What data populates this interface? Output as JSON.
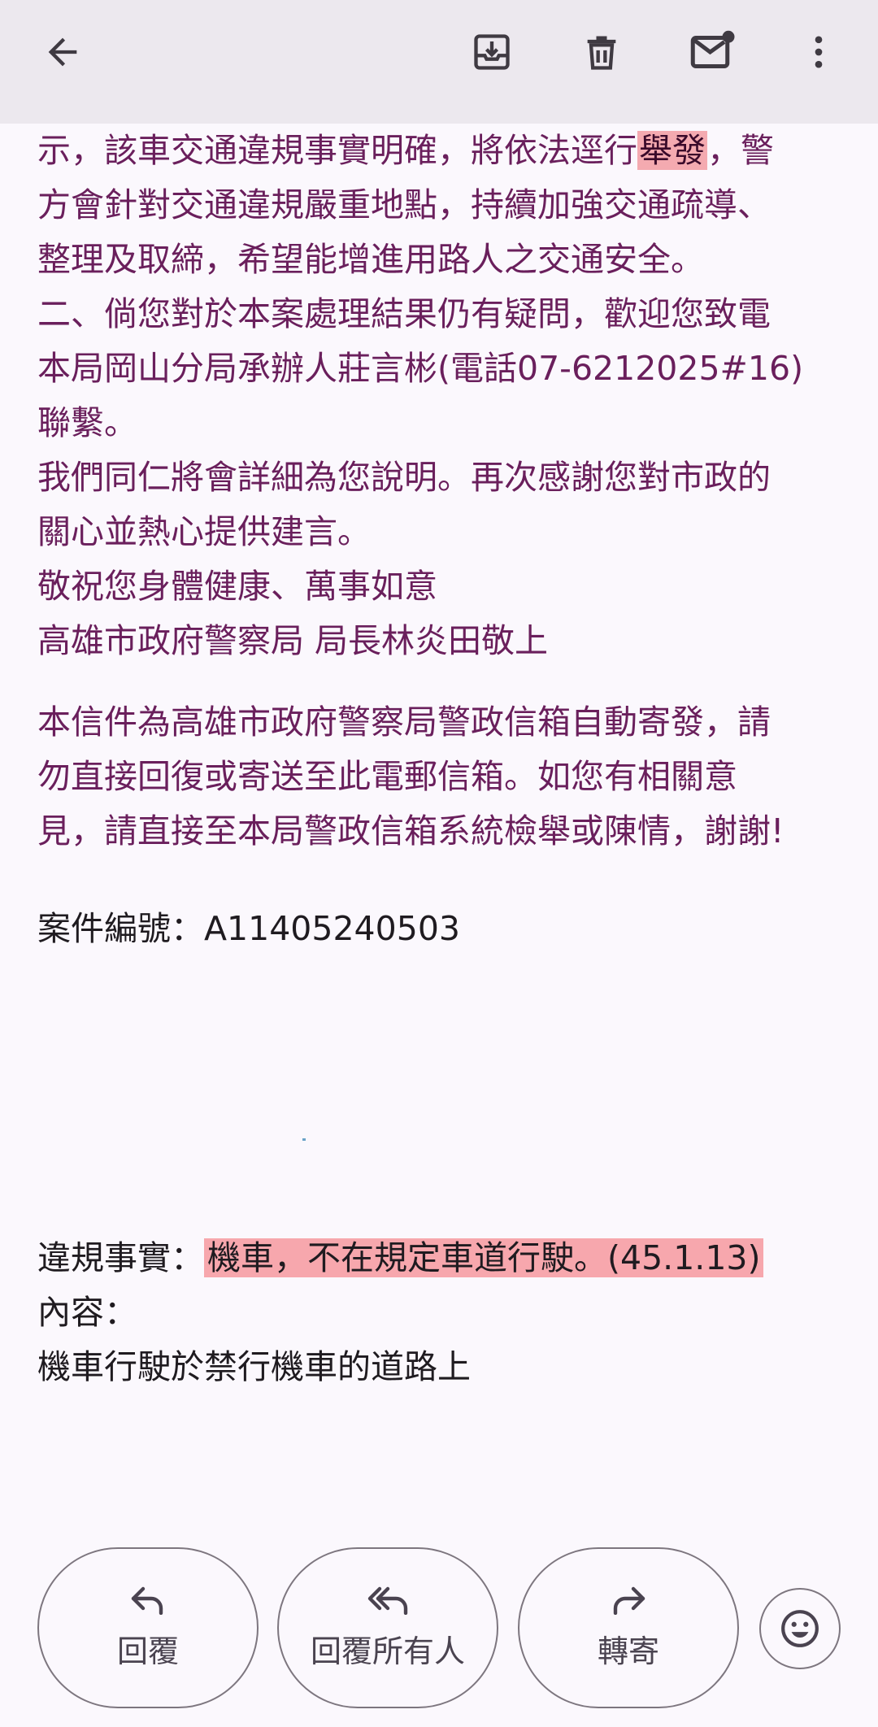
{
  "body_lines": {
    "l1_pre": "示，該車交通違規事實明確，將依法逕行",
    "l1_hl": "舉發",
    "l1_post": "，警",
    "l2": "方會針對交通違規嚴重地點，持續加強交通疏導、",
    "l3": "整理及取締，希望能增進用路人之交通安全。",
    "l4": "二、倘您對於本案處理結果仍有疑問，歡迎您致電",
    "l5": "本局岡山分局承辦人莊言彬(電話07-6212025#16)",
    "l6": "聯繫。",
    "l7": "我們同仁將會詳細為您說明。再次感謝您對市政的",
    "l8": "關心並熱心提供建言。",
    "l9": "敬祝您身體健康、萬事如意",
    "l10": "高雄市政府警察局 局長林炎田敬上"
  },
  "notice_lines": {
    "n1": "本信件為高雄市政府警察局警政信箱自動寄發，請",
    "n2": "勿直接回復或寄送至此電郵信箱。如您有相關意",
    "n3": "見，請直接至本局警政信箱系統檢舉或陳情，謝謝!"
  },
  "case": {
    "label": "案件編號：",
    "number": "A11405240503"
  },
  "violation": {
    "label": "違規事實：",
    "value": "機車，不在規定車道行駛。(45.1.13)",
    "content_label": "內容：",
    "content_value": "機車行駛於禁行機車的道路上"
  },
  "actions": {
    "reply": "回覆",
    "reply_all": "回覆所有人",
    "forward": "轉寄"
  },
  "icons": {
    "back": "arrow-left-icon",
    "archive": "archive-icon",
    "delete": "trash-icon",
    "mark_unread": "mail-unread-icon",
    "more": "more-vert-icon",
    "reply": "reply-icon",
    "reply_all": "reply-all-icon",
    "forward": "forward-icon",
    "emoji": "emoji-icon"
  },
  "colors": {
    "body_text": "#6a1f5c",
    "dark_text": "#1f1b20",
    "highlight": "#f4aab0",
    "topbar_bg": "#ece8ee",
    "page_bg": "#fbf8fd"
  }
}
